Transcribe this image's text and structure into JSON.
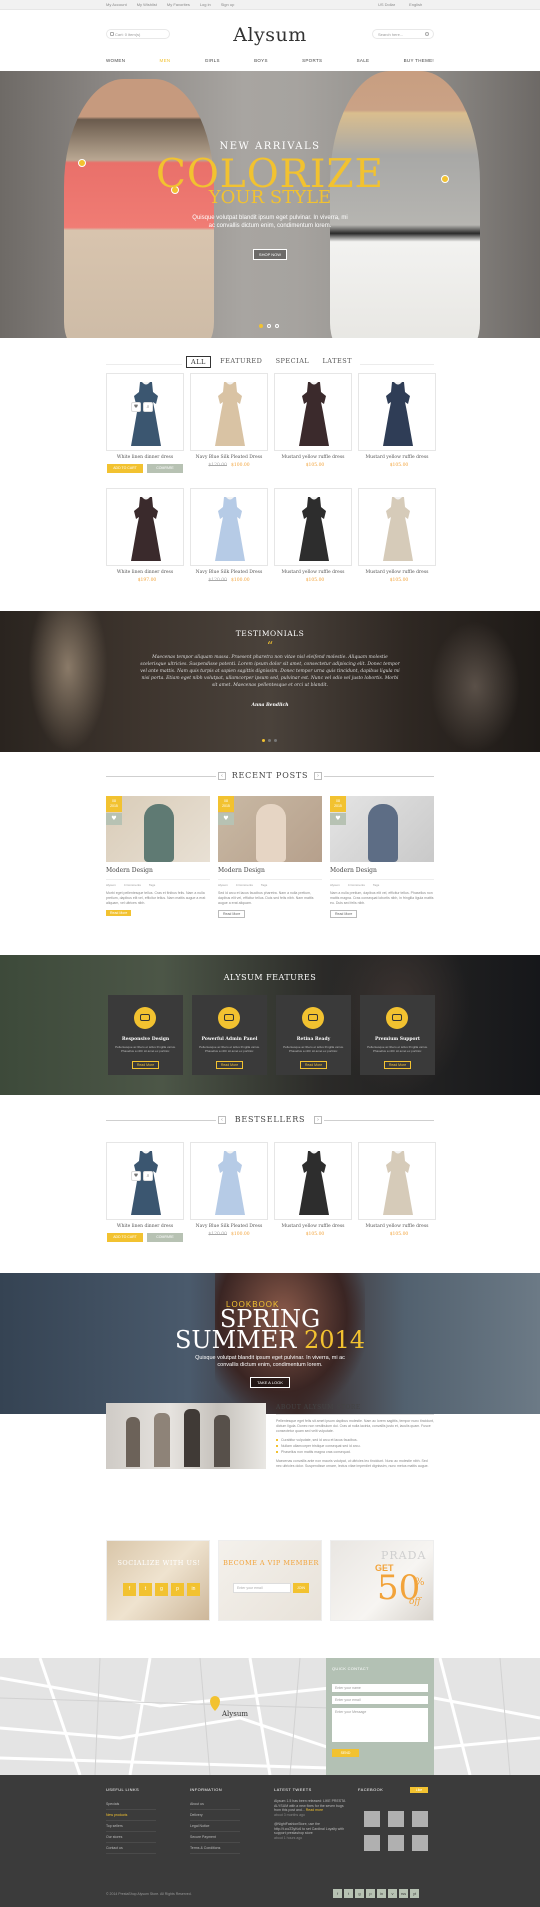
{
  "topbar": {
    "links": [
      "My Account",
      "My Wishlist",
      "My Favorites",
      "Log in",
      "Sign up"
    ],
    "currency": "US Dollar",
    "language": "English"
  },
  "header": {
    "cart_label": "Cart: 0 item(s)",
    "logo": "Alysum",
    "search_placeholder": "Search here..."
  },
  "nav": {
    "items": [
      "WOMEN",
      "MEN",
      "GIRLS",
      "BOYS",
      "SPORTS",
      "SALE",
      "BUY THEME!"
    ],
    "active_index": 1
  },
  "hero": {
    "kicker": "NEW ARRIVALS",
    "title": "COLORIZE",
    "subtitle": "YOUR STYLE",
    "text": "Quisque volutpat blandit ipsum eget pulvinar. In viverra, mi ac convallis dictum enim, condimentum lorem.",
    "button": "SHOP NOW",
    "slide_count": 3,
    "active_slide": 1
  },
  "tabs": {
    "items": [
      "ALL",
      "FEATURED",
      "SPECIAL",
      "LATEST"
    ],
    "active_index": 0
  },
  "products": [
    {
      "name": "White linen dinner dress",
      "price": "",
      "old_price": "",
      "color": "#3b5670",
      "highlight": true,
      "add_label": "ADD TO CART",
      "compare_label": "COMPARE"
    },
    {
      "name": "Navy Blue Silk Pleated Dress",
      "price": "$100.00",
      "old_price": "$120.00",
      "color": "#d9c3a4"
    },
    {
      "name": "Mustard yellow ruffle dress",
      "price": "$105.00",
      "old_price": "",
      "color": "#3b2a2c"
    },
    {
      "name": "Mustard yellow ruffle dress",
      "price": "$105.00",
      "old_price": "",
      "color": "#2f3d56"
    },
    {
      "name": "White linen dinner dress",
      "price": "$197.00",
      "old_price": "",
      "color": "#3a2a2c"
    },
    {
      "name": "Navy Blue Silk Pleated Dress",
      "price": "$100.00",
      "old_price": "$120.00",
      "color": "#b6cbe6"
    },
    {
      "name": "Mustard yellow ruffle dress",
      "price": "$105.00",
      "old_price": "",
      "color": "#2d2d2d"
    },
    {
      "name": "Mustard yellow ruffle dress",
      "price": "$105.00",
      "old_price": "",
      "color": "#d6cbb9"
    }
  ],
  "testimonials": {
    "title": "TESTIMONIALS",
    "quote_mark": "“",
    "text": "Maecenas tempor aliquam massa. Praesent pharetra non vitae nisl eleifend molestie. Aliquam molestie scelerisque ultricies. Suspendisse potenti. Lorem ipsum dolor sit amet, consectetur adipiscing elit. Donec tempor vel ante mattis. Nam quis turpis at sapien sagittis dignissim. Donec tempor urna quis tincidunt, dapibus ligula mi nisi porta. Etiam eget nibh volutpat, ullamcorper ipsum sed, pulvinar est. Nunc vel odio vel justo lobortis. Morbi sit amet. Maecenas pellentesque et orci ut blandit.",
    "author": "Anna Bendlich",
    "dot_count": 3,
    "active_dot": 1
  },
  "recent_posts": {
    "title": "RECENT POSTS",
    "prev": "‹",
    "next": "›",
    "items": [
      {
        "day": "08",
        "month": "2015",
        "title": "Modern Design",
        "meta": [
          "Alysum",
          "4 Comments",
          "Tags"
        ],
        "body": "Morbi eget pellentesque tellus. Cras et finibus felis. Nam a nulla pretium, dapibus elit vel, efficitur tellus. Nam mattis augue a erat aliquam, vel ultrices nibh.",
        "more": "Read More",
        "img": [
          "#d9ccb8",
          "#5f7a73",
          "#e8e0d4"
        ]
      },
      {
        "day": "08",
        "month": "2015",
        "title": "Modern Design",
        "meta": [
          "Alysum",
          "4 Comments",
          "Tags"
        ],
        "body": "Sed id arcu et lacus faucibus pharetra. Nam a nulla pretium, dapibus elit vel, efficitur tellus. Duis sed felis nibh. Nam mattis augue a erat aliquam.",
        "more": "Read More",
        "img": [
          "#c9b9a4",
          "#e6d5c4",
          "#b6a08c"
        ]
      },
      {
        "day": "08",
        "month": "2015",
        "title": "Modern Design",
        "meta": [
          "Alysum",
          "4 Comments",
          "Tags"
        ],
        "body": "Nam a nulla pretium, dapibus elit vel, efficitur tellus. Phasellus non mattis magna. Cras consequat lobortis nibh, in fringilla ligula mattis eu. Duis sed felis nibh.",
        "more": "Read More",
        "img": [
          "#e4e4e4",
          "#5d6d85",
          "#c9c9c9"
        ]
      }
    ]
  },
  "features": {
    "title": "ALYSUM FEATURES",
    "items": [
      {
        "title": "Responsive Design",
        "text": "Pellentesque ac libero et tellus fringilla varius. Phasellus a nibh sit amet ex porttitor.",
        "button": "Read More"
      },
      {
        "title": "Powerful Admin Panel",
        "text": "Pellentesque ac libero et tellus fringilla varius. Phasellus a nibh sit amet ex porttitor.",
        "button": "Read More"
      },
      {
        "title": "Retina Ready",
        "text": "Pellentesque ac libero et tellus fringilla varius. Phasellus a nibh sit amet ex porttitor.",
        "button": "Read More"
      },
      {
        "title": "Premium Support",
        "text": "Pellentesque ac libero et tellus fringilla varius. Phasellus a nibh sit amet ex porttitor.",
        "button": "Read More"
      }
    ]
  },
  "bestsellers": {
    "title": "BESTSELLERS",
    "prev": "‹",
    "next": "›",
    "items": [
      {
        "name": "White linen dinner dress",
        "price": "",
        "old_price": "",
        "color": "#3b5670",
        "highlight": true,
        "add_label": "ADD TO CART",
        "compare_label": "COMPARE"
      },
      {
        "name": "Navy Blue Silk Pleated Dress",
        "price": "$100.00",
        "old_price": "$120.00",
        "color": "#b6cbe6"
      },
      {
        "name": "Mustard yellow ruffle dress",
        "price": "$105.00",
        "old_price": "",
        "color": "#2d2d2d"
      },
      {
        "name": "Mustard yellow ruffle dress",
        "price": "$105.00",
        "old_price": "",
        "color": "#d6cbb9"
      }
    ]
  },
  "lookbook": {
    "kicker": "LOOKBOOK",
    "line1": "SPRING",
    "line2a": "SUMMER",
    "line2b": "2014",
    "text": "Quisque volutpat blandit ipsum eget pulvinar. In viverra, mi ac convallis dictum enim, condimentum lorem.",
    "button": "TAKE A LOOK"
  },
  "about": {
    "title": "ABOUT ALYSUM STORE",
    "text": "Pellentesque eget felis sit amet ipsum dapibus molestie. Nam ac lorem sagittis, tempor nunc tincidunt, dictum ligula. Donec non vestibulum dui. Cras at nulla lacinia, convallis justo et, iaculis quam. Fusce consectetur quam sed velit vulputate.",
    "bullets": [
      "Curabitur vulputate, sed id arcu et lacus faucibus.",
      "Nullam ullamcorper tristique consequat sed id arcu.",
      "Phasellus non mattis magna cras consequat."
    ],
    "text2": "Maecenas convallis ante non mauris volutpat, ut ultricies leo tincidunt. Nunc ac molestie nibh. Sed nec ultricies dolor. Suspendisse ornare, lectus vitae imperdiet dignissim, nunc metus mattis augue."
  },
  "promos": [
    {
      "title": "SOCIALIZE WITH US!",
      "icons": [
        "f",
        "t",
        "g",
        "p",
        "in"
      ]
    },
    {
      "title": "BECOME A VIP MEMBER",
      "placeholder": "Enter your email",
      "button": "JOIN"
    },
    {
      "title": "PRADA",
      "big": "50",
      "pct": "%",
      "off": "off",
      "prefix": "GET"
    }
  ],
  "map_label": "Alysum",
  "quick_contact": {
    "title": "QUICK CONTACT",
    "name_ph": "Enter your name",
    "email_ph": "Enter your email",
    "msg_ph": "Enter your Message",
    "send": "SEND"
  },
  "footer": {
    "useful_title": "USEFUL LINKS",
    "useful": [
      "Specials",
      "New products",
      "Top sellers",
      "Our stores",
      "Contact us"
    ],
    "useful_active": 1,
    "info_title": "INFORMATION",
    "info": [
      "About us",
      "Delivery",
      "Legal Notice",
      "Secure Payment",
      "Terms & Conditions"
    ],
    "tweets_title": "LATEST TWEETS",
    "tweets": [
      {
        "text": "Alysum 1.5 has been released: LIKE PRESTA ALYSUM with a new fixes for the seven bugs from this post and...",
        "link": "Read more",
        "time": "about 3 months ago"
      },
      {
        "text": "@NightFashionStore, use the http://t.co/Z3yKc6 to set Cardinal Loyalty with support prestashop store",
        "link": "",
        "time": "about 1 hours ago"
      }
    ],
    "fb_title": "FACEBOOK",
    "fb_like": "Like",
    "copyright": "© 2014 PrestaShop Alysum Store. All Rights Reserved.",
    "social": [
      "f",
      "t",
      "g",
      "p",
      "in",
      "v",
      "rss",
      "yt"
    ]
  },
  "colors": {
    "accent": "#f2c230",
    "sage": "#b7c2b3",
    "footer": "#3b3b3b"
  }
}
